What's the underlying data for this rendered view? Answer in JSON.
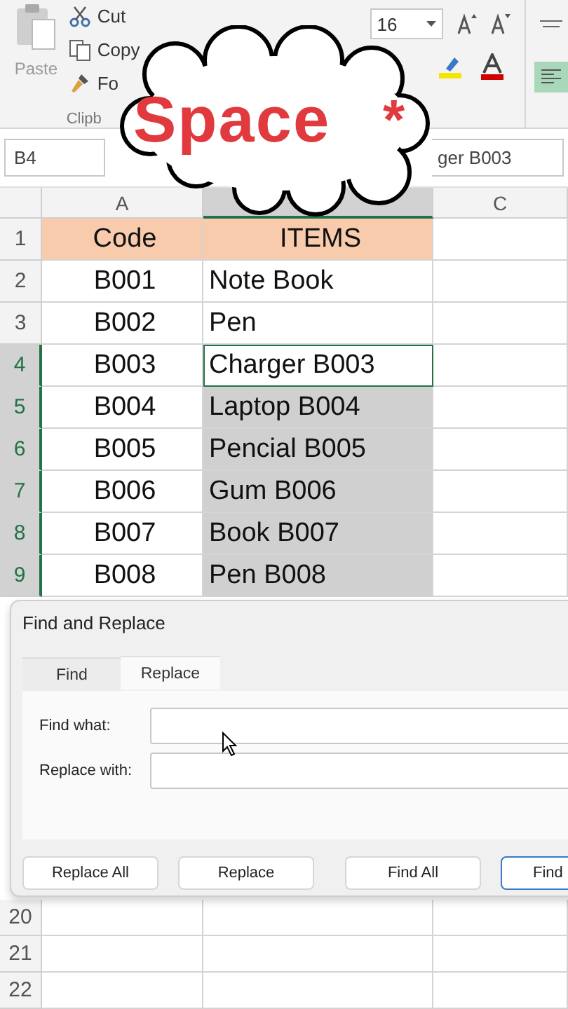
{
  "ribbon": {
    "paste": "Paste",
    "clipboard_items": [
      {
        "label": "Cut",
        "kind": "cut"
      },
      {
        "label": "Copy",
        "kind": "copy"
      },
      {
        "label": "Fo",
        "kind": "format"
      }
    ],
    "group_label": "Clipb",
    "font_size": "16"
  },
  "callout": {
    "text": "Space",
    "mark": "*"
  },
  "formula_bar": {
    "name_box": "B4",
    "value": "ger B003"
  },
  "column_headers": {
    "a": "A",
    "c": "C"
  },
  "rows": [
    {
      "number": "1",
      "kind": "header",
      "selected": false,
      "code": "Code",
      "item": "ITEMS"
    },
    {
      "number": "2",
      "kind": "data",
      "selected": false,
      "code": "B001",
      "item": "Note Book",
      "highlighted": false
    },
    {
      "number": "3",
      "kind": "data",
      "selected": false,
      "code": "B002",
      "item": "Pen",
      "highlighted": false
    },
    {
      "number": "4",
      "kind": "data",
      "selected": true,
      "code": "B003",
      "item": "Charger B003",
      "highlighted": false
    },
    {
      "number": "5",
      "kind": "data",
      "selected": true,
      "code": "B004",
      "item": "Laptop B004",
      "highlighted": true
    },
    {
      "number": "6",
      "kind": "data",
      "selected": true,
      "code": "B005",
      "item": "Pencial B005",
      "highlighted": true
    },
    {
      "number": "7",
      "kind": "data",
      "selected": true,
      "code": "B006",
      "item": "Gum B006",
      "highlighted": true
    },
    {
      "number": "8",
      "kind": "data",
      "selected": true,
      "code": "B007",
      "item": "Book B007",
      "highlighted": true
    },
    {
      "number": "9",
      "kind": "data",
      "selected": true,
      "code": "B008",
      "item": "Pen B008",
      "highlighted": true
    }
  ],
  "lower_rows": [
    {
      "number": "20"
    },
    {
      "number": "21"
    },
    {
      "number": "22"
    }
  ],
  "dialog": {
    "title": "Find and Replace",
    "tabs": [
      {
        "label": "Find",
        "selected": false
      },
      {
        "label": "Replace",
        "selected": true
      }
    ],
    "fields": [
      {
        "label": "Find what:"
      },
      {
        "label": "Replace with:"
      }
    ],
    "buttons": [
      {
        "label": "Replace All",
        "kind": "plain"
      },
      {
        "label": "Replace",
        "kind": "plain"
      },
      {
        "label": "Find All",
        "kind": "plain"
      },
      {
        "label": "Find",
        "kind": "default"
      }
    ]
  }
}
